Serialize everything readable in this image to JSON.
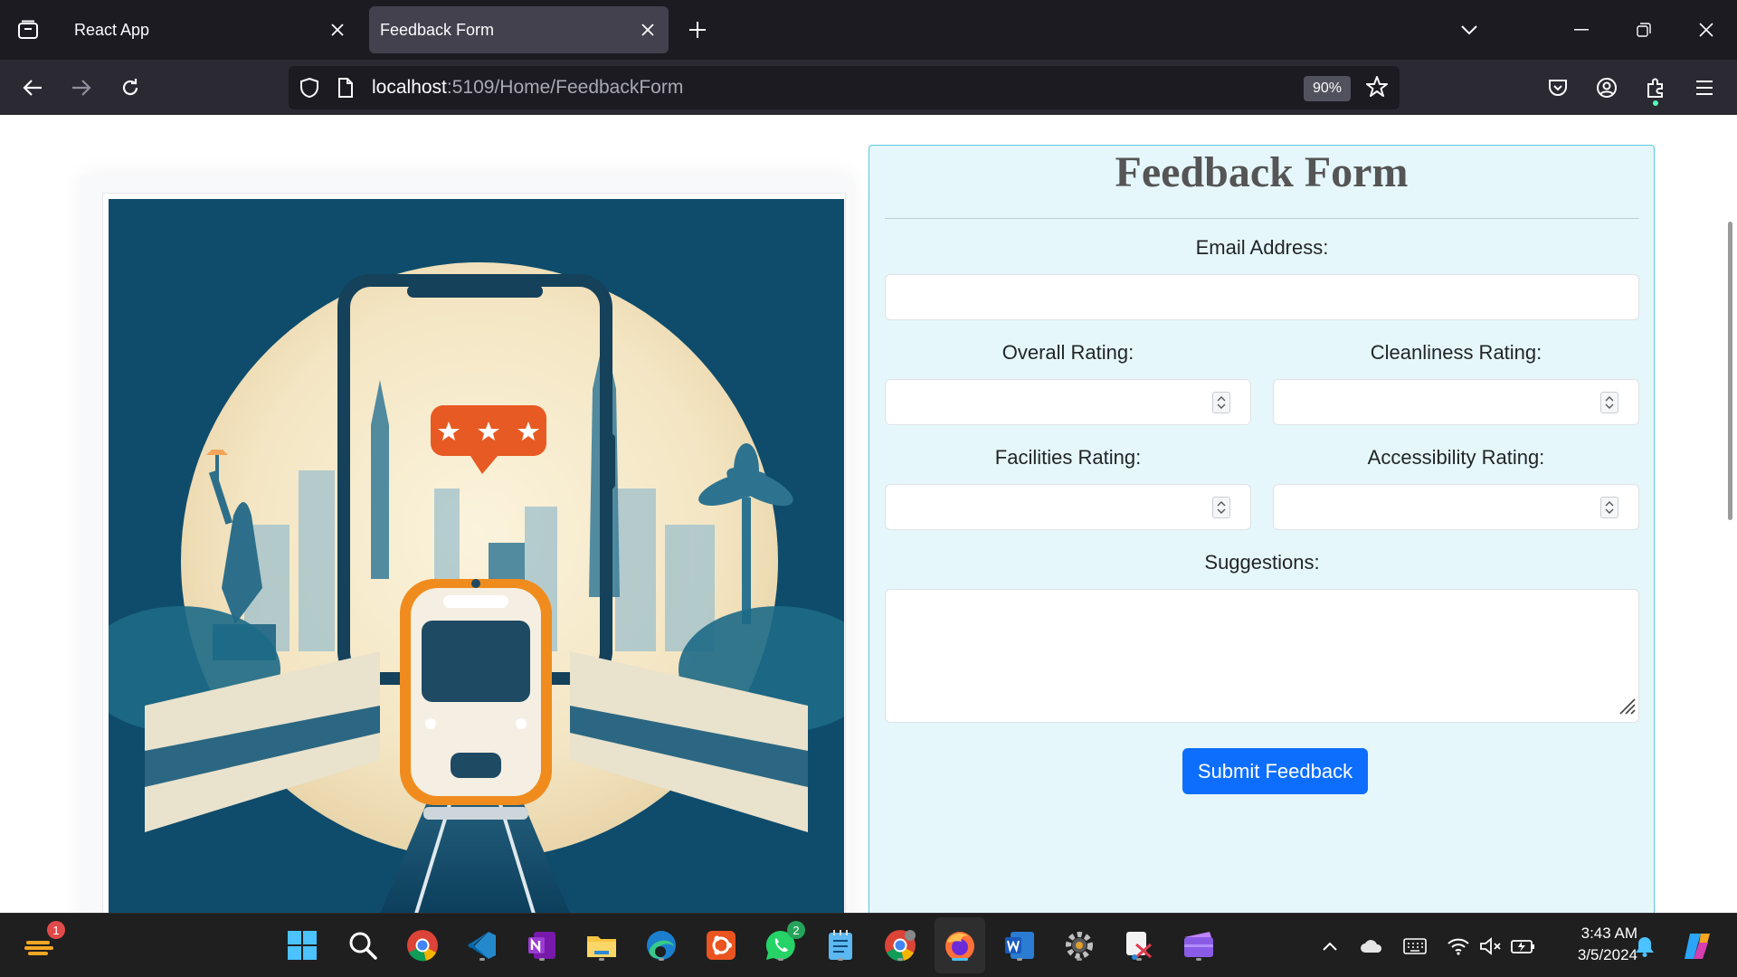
{
  "browser": {
    "tabs": [
      {
        "label": "React App"
      },
      {
        "label": "Feedback Form"
      }
    ],
    "url": {
      "host": "localhost",
      "rest": ":5109/Home/FeedbackForm"
    },
    "zoom": "90%"
  },
  "form": {
    "title": "Feedback Form",
    "email_label": "Email Address:",
    "email_value": "",
    "overall_label": "Overall Rating:",
    "cleanliness_label": "Cleanliness Rating:",
    "facilities_label": "Facilities Rating:",
    "accessibility_label": "Accessibility Rating:",
    "suggestions_label": "Suggestions:",
    "submit_label": "Submit Feedback"
  },
  "taskbar": {
    "notification_badge": "1",
    "whatsapp_badge": "2",
    "time": "3:43 AM",
    "date": "3/5/2024"
  },
  "colors": {
    "form_bg": "#e6f7fb",
    "form_border": "#5ac8dc",
    "submit_bg": "#0d6efd",
    "illustration_bg": "#0f4c6b"
  }
}
